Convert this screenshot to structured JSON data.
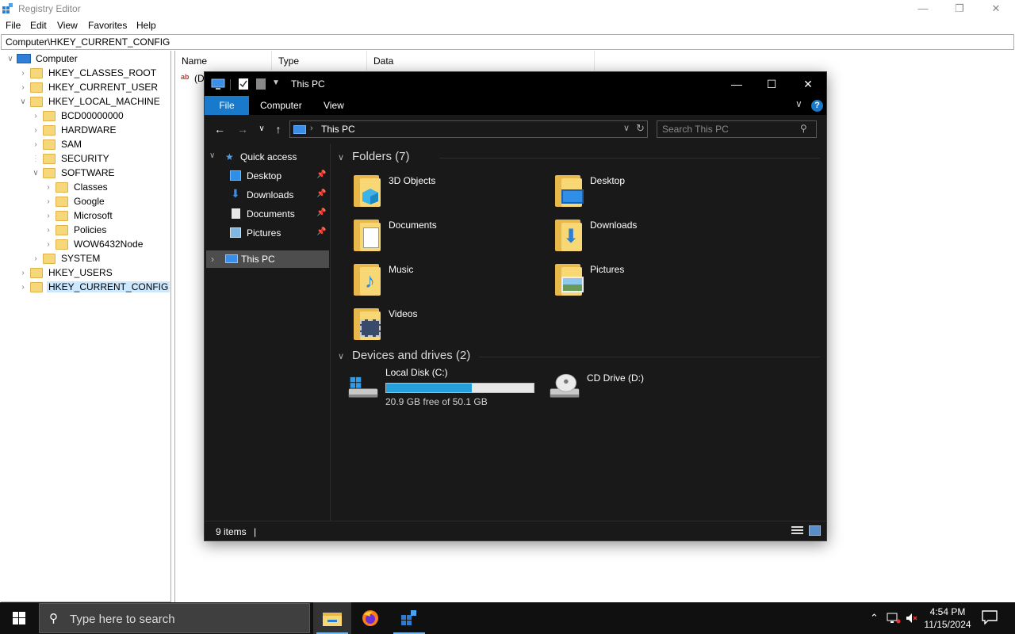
{
  "registry": {
    "title": "Registry Editor",
    "menu": [
      "File",
      "Edit",
      "View",
      "Favorites",
      "Help"
    ],
    "address": "Computer\\HKEY_CURRENT_CONFIG",
    "tree": [
      {
        "label": "Computer",
        "level": 0,
        "expanded": true
      },
      {
        "label": "HKEY_CLASSES_ROOT",
        "level": 1
      },
      {
        "label": "HKEY_CURRENT_USER",
        "level": 1
      },
      {
        "label": "HKEY_LOCAL_MACHINE",
        "level": 1,
        "expanded": true
      },
      {
        "label": "BCD00000000",
        "level": 2
      },
      {
        "label": "HARDWARE",
        "level": 2
      },
      {
        "label": "SAM",
        "level": 2
      },
      {
        "label": "SECURITY",
        "level": 2
      },
      {
        "label": "SOFTWARE",
        "level": 2,
        "expanded": true
      },
      {
        "label": "Classes",
        "level": 3
      },
      {
        "label": "Google",
        "level": 3
      },
      {
        "label": "Microsoft",
        "level": 3
      },
      {
        "label": "Policies",
        "level": 3
      },
      {
        "label": "WOW6432Node",
        "level": 3
      },
      {
        "label": "SYSTEM",
        "level": 2
      },
      {
        "label": "HKEY_USERS",
        "level": 1
      },
      {
        "label": "HKEY_CURRENT_CONFIG",
        "level": 1,
        "selected": true
      }
    ],
    "columns": [
      "Name",
      "Type",
      "Data"
    ],
    "row_name_partial": "(D",
    "row_icon_text": "ab"
  },
  "explorer": {
    "title": "This PC",
    "ribbon_tabs": [
      "File",
      "Computer",
      "View"
    ],
    "help_label": "?",
    "address_path": "This PC",
    "search_placeholder": "Search This PC",
    "nav": {
      "quick_access": "Quick access",
      "pinned": [
        "Desktop",
        "Downloads",
        "Documents",
        "Pictures"
      ],
      "this_pc": "This PC"
    },
    "folders_header": "Folders (7)",
    "folders": [
      "3D Objects",
      "Desktop",
      "Documents",
      "Downloads",
      "Music",
      "Pictures",
      "Videos"
    ],
    "devices_header": "Devices and drives (2)",
    "drives": [
      {
        "name": "Local Disk (C:)",
        "free_text": "20.9 GB free of 50.1 GB",
        "used_fraction": 0.583
      },
      {
        "name": "CD Drive (D:)"
      }
    ],
    "status_count": "9 items"
  },
  "taskbar": {
    "search_placeholder": "Type here to search",
    "clock_time": "4:54 PM",
    "clock_date": "11/15/2024",
    "apps": [
      "file-explorer",
      "firefox",
      "registry-editor"
    ]
  },
  "colors": {
    "accent": "#1979ca",
    "explorer_bg": "#191919",
    "drive_fill": "#26a0da",
    "folder_yellow": "#f8d775"
  }
}
